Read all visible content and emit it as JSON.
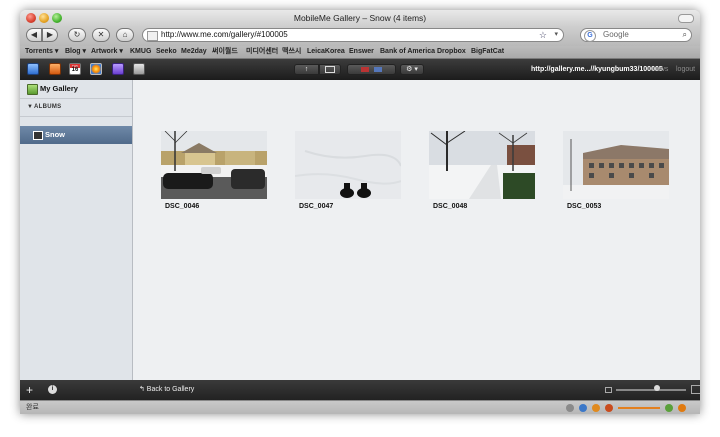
{
  "window": {
    "title": "MobileMe Gallery – Snow (4 items)"
  },
  "browser": {
    "back_label": "◀",
    "forward_label": "▶",
    "reload_label": "↻",
    "stop_label": "✕",
    "home_label": "⌂",
    "address": "http://www.me.com/gallery/#100005",
    "search_placeholder": "Google",
    "star_glyph": "☆",
    "dropdown_glyph": "▾",
    "lens_glyph": "⌕"
  },
  "bookmarks": [
    "Torrents ▾",
    "Blog ▾",
    "Artwork ▾",
    "KMUG",
    "Seeko",
    "Me2day",
    "써이월드",
    "미디어센터",
    "맥쓰시",
    "LeicaKorea",
    "Enswer",
    "Bank of America",
    "Dropbox",
    "BigFatCat"
  ],
  "appbar": {
    "calendar_month": "TUE",
    "calendar_day": "16",
    "upload_glyph": "↑",
    "settings_glyph": "⚙ ▾",
    "gallery_url": "http://gallery.me...//kyungbum33/100005",
    "news_label": "news",
    "logout_label": "logout"
  },
  "sidebar": {
    "my_gallery_label": "My Gallery",
    "albums_header": "ALBUMS",
    "albums_toggle": "▼",
    "albums": [
      {
        "label": "Snow"
      }
    ],
    "add_label": "+",
    "info_label": "i"
  },
  "photos": [
    {
      "caption": "DSC_0046"
    },
    {
      "caption": "DSC_0047"
    },
    {
      "caption": "DSC_0048"
    },
    {
      "caption": "DSC_0053"
    }
  ],
  "footer": {
    "back_to_gallery": "↰ Back to Gallery"
  },
  "statusbar": {
    "text": "완료"
  }
}
